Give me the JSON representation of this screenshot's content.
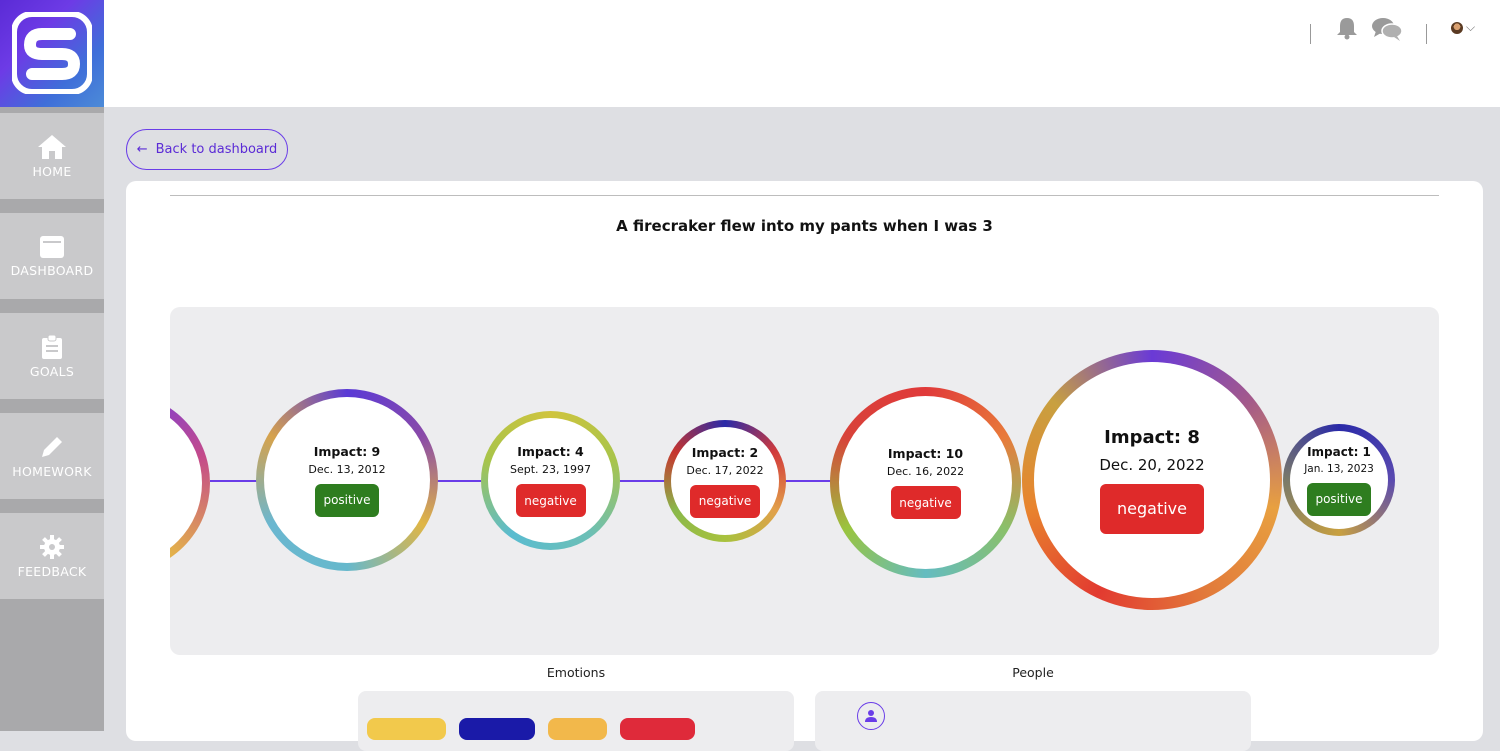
{
  "sidebar": {
    "logo_icon": "brand-logo-icon",
    "items": [
      {
        "label": "HOME",
        "icon": "home-icon"
      },
      {
        "label": "DASHBOARD",
        "icon": "dashboard-icon"
      },
      {
        "label": "GOALS",
        "icon": "clipboard-icon"
      },
      {
        "label": "HOMEWORK",
        "icon": "pencil-icon"
      },
      {
        "label": "FEEDBACK",
        "icon": "gear-icon"
      }
    ]
  },
  "header": {
    "icons": [
      "bell-icon",
      "chat-icon",
      "avatar",
      "chevron-down-icon"
    ],
    "caret": "⌵"
  },
  "back_button": {
    "label": "Back to dashboard",
    "arrow": "←"
  },
  "memory": {
    "title": "A firecraker flew into my pants when I was 3"
  },
  "timeline": {
    "events": [
      {
        "impact": "Impact: 9",
        "date": "Dec. 13, 2012",
        "sentiment": "positive"
      },
      {
        "impact": "Impact: 4",
        "date": "Sept. 23, 1997",
        "sentiment": "negative"
      },
      {
        "impact": "Impact: 2",
        "date": "Dec. 17, 2022",
        "sentiment": "negative"
      },
      {
        "impact": "Impact: 10",
        "date": "Dec. 16, 2022",
        "sentiment": "negative"
      },
      {
        "impact": "Impact: 8",
        "date": "Dec. 20, 2022",
        "sentiment": "negative"
      },
      {
        "impact": "Impact: 1",
        "date": "Jan. 13, 2023",
        "sentiment": "positive"
      }
    ]
  },
  "sections": {
    "emotions_label": "Emotions",
    "people_label": "People"
  },
  "colors": {
    "accent": "#6a3de8",
    "positive": "#2e7d1f",
    "negative": "#df2a2a",
    "chip_colors": [
      "#f2c94c",
      "#1a1aa8",
      "#f2b84b",
      "#df2a3a"
    ]
  }
}
